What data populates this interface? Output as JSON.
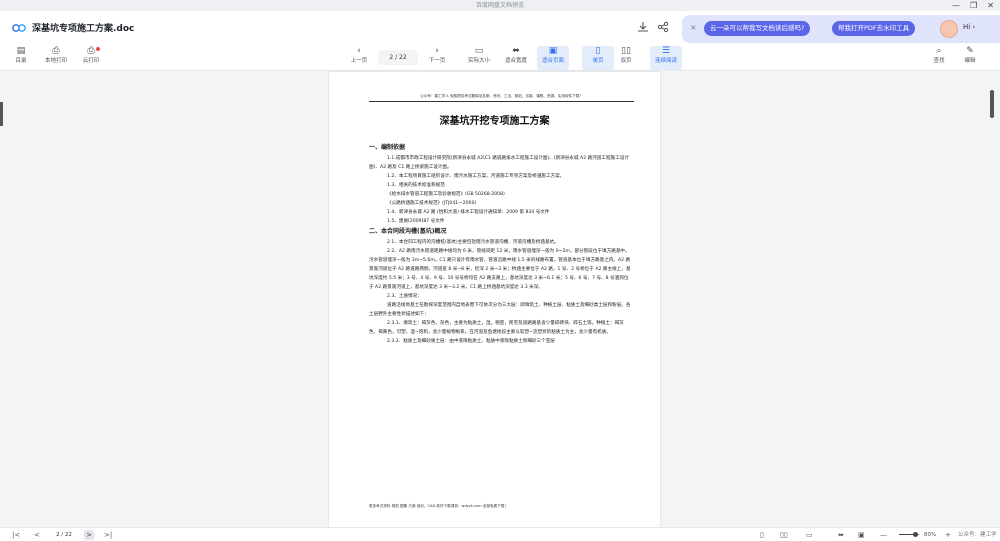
{
  "window": {
    "title": "百度网盘文档预览",
    "controls": [
      "—",
      "❐",
      "✕"
    ]
  },
  "header": {
    "doc_title": "深基坑专项施工方案.doc",
    "download_icon": "download-icon",
    "share_icon": "share-icon"
  },
  "ai_bar": {
    "close": "×",
    "suggestion_1": "云一朵可以帮我写文档读后感吗?",
    "suggestion_2": "帮我打开PDF去水印工具",
    "greeting": "Hi ›"
  },
  "toolbar": {
    "catalog": "目录",
    "local_print": "本地打印",
    "cloud_print": "云打印",
    "prev_page": "上一页",
    "page_indicator": "2 / 22",
    "next_page": "下一页",
    "actual_size": "实际大小",
    "fit_width": "适合宽度",
    "fit_page": "适合页面",
    "single_page": "单页",
    "double_page": "双页",
    "continuous_read": "连续阅读",
    "search": "查找",
    "edit": "编辑"
  },
  "document": {
    "page_header": "公众号：建工学人  免费提供考试题库及答案、资讯、工法、规范、试卷、课程、资源、实用软件下载！",
    "title": "深基坑开挖专项施工方案",
    "section1_heading": "一、编制依据",
    "s1_1": "1.1.成都市市政工程设计研究院(新津县永城 A2\\C1 路道路排水工程施工设计图)、(新津县永城 A2 路河道工程施工设计图)、A2 路及 C1 路上桥梁施工设计图。",
    "s1_2": "1.2、本工程项目施工组织设计、雨污水施工方案、河道施工专项方案及桥涵施工方案。",
    "s1_3": "1.3、相关的技术标准和规范",
    "s1_3a": "《给水排水管道工程施工及验收规范》(GB 50268-2008)",
    "s1_3b": "《公路桥涵施工技术规范》(JTJ041—2000)",
    "s1_4": "1.4、新津县永城 A2 路 (怡和大道) 排水工程设计通知单：2009 第 834 号文件",
    "s1_5": "1.5、建质[2009]87 号文件",
    "section2_heading": "二、本合同段沟槽(基坑)概况",
    "s2_1": "2.1、本合同工程内的沟槽桩(基坑)主要包括雨污水管道沟槽、河道沟槽及桥涵基坑。",
    "s2_2": "2.2、A2 路雨污水管道距路中线均为 6 米，管线间距 12 米，雨水管道埋深一般为 0~2m，部分管段位于填方路基中，污水管道埋深一般为 3m~5.6m。C1 路只设计有雨水管，管道沿路中线 1.5 米的线路布置，管道基本位于填方路基之内。A2 路景观河道位于 A2 路道路两侧，河道宽 8 米~8 米，挖深 2 米~3 米；桥涵主要位于 A2 路，1 号、2 号桥位于 A2 路主线上，基坑深度约 5.5 米；3 号、4 号、9 号、10 号号桥均在 A2 路支路上，基坑深度达 3 米~6.1 米；5 号、6 号、7 号、8 号涵洞位于 A2 路景观河道上，基坑深度达 3 米~3.2 米。C1 路上桥涵基坑深度达 3.3 米深。",
    "s2_3": "2.3、土质情况：",
    "s2_3_text": "道路沿线地基土在勘探深度范围内自地表而下可依次分为三大层：即填筑土、种植土层、粘质土及细砂类土层和粉层。各土层野外主要性状描述如下：",
    "s2_3_1": "2.3.1、填筑土：褐灰色、杂色，主要为粘质土，湿，稍密，民宅及道路路基含少量碎砖块、碎石土等。种植土：褐灰色、褐黄色，可塑，湿~饱和，含少量植物根系。在河道及鱼塘地段主要以软塑~流塑状的粘质土为主，含少量有机质。",
    "s2_3_2": "2.3.2、粘质土及细砂质土层：由中液限粘质土、粘质中液限粘质土和细砂三个亚层",
    "page_footer": "更多考试资料 规范 图集 方案 培训、CAD 软件下载请到：wdzyk.com 全部免费下载！"
  },
  "statusbar": {
    "first": "|<",
    "prev": "<",
    "page_indicator": "2 / 22",
    "next": ">",
    "last": ">|",
    "zoom_minus": "—",
    "zoom_value": "80%",
    "zoom_plus": "+",
    "zoom_level": 0.8,
    "watermark": "公众号：建工学人"
  }
}
